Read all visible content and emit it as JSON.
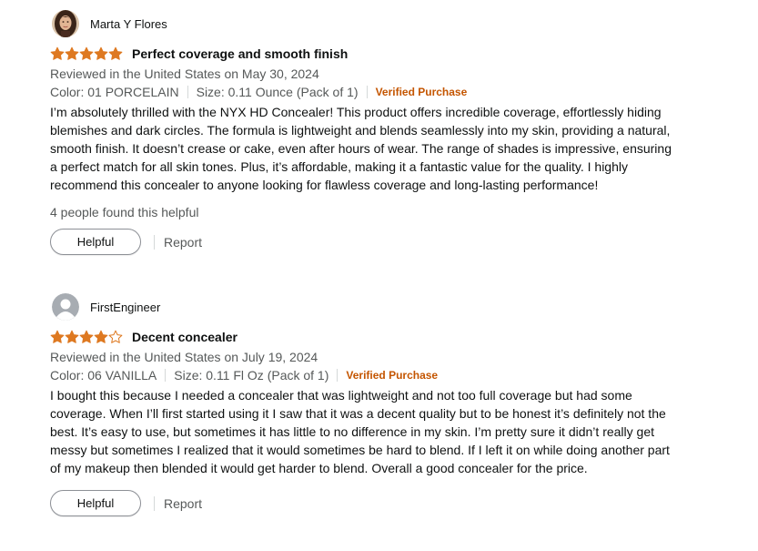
{
  "colors": {
    "star": "#de7921",
    "verified": "#c45500",
    "muted_text": "#565959",
    "text": "#0f1111"
  },
  "reviews": [
    {
      "author": "Marta Y Flores",
      "avatar": "profile-photo",
      "rating": 5,
      "max_rating": 5,
      "title": "Perfect coverage and smooth finish",
      "date": "Reviewed in the United States on May 30, 2024",
      "color": "Color: 01 PORCELAIN",
      "size": "Size: 0.11 Ounce (Pack of 1)",
      "verified": "Verified Purchase",
      "body": "I’m absolutely thrilled with the NYX HD Concealer! This product offers incredible coverage, effortlessly hiding blemishes and dark circles. The formula is lightweight and blends seamlessly into my skin, providing a natural, smooth finish. It doesn’t crease or cake, even after hours of wear. The range of shades is impressive, ensuring a perfect match for all skin tones. Plus, it’s affordable, making it a fantastic value for the quality. I highly recommend this concealer to anyone looking for flawless coverage and long-lasting performance!",
      "helpful_count": "4 people found this helpful",
      "helpful_label": "Helpful",
      "report_label": "Report"
    },
    {
      "author": "FirstEngineer",
      "avatar": "default-user-icon",
      "rating": 4,
      "max_rating": 5,
      "title": "Decent concealer",
      "date": "Reviewed in the United States on July 19, 2024",
      "color": "Color: 06 VANILLA",
      "size": "Size: 0.11 Fl Oz (Pack of 1)",
      "verified": "Verified Purchase",
      "body": "I bought this because I needed a concealer that was lightweight and not too full coverage but had some coverage. When I’ll first started using it I saw that it was a decent quality but to be honest it’s definitely not the best. It’s easy to use, but sometimes it has little to no difference in my skin. I’m pretty sure it didn’t really get messy but sometimes I realized that it would sometimes be hard to blend. If I left it on while doing another part of my makeup then blended it would get harder to blend. Overall a good concealer for the price.",
      "helpful_label": "Helpful",
      "report_label": "Report"
    }
  ]
}
